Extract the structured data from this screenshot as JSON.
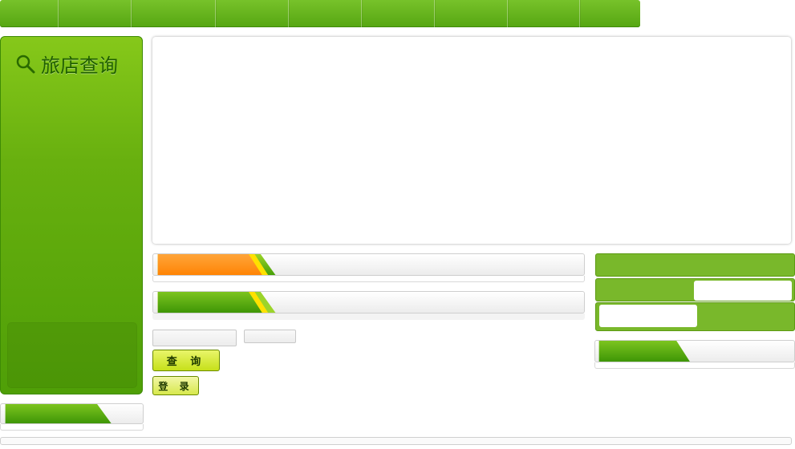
{
  "nav": {
    "tab_count": 9
  },
  "sidebar": {
    "title": "旅店查询",
    "icon": "search-icon"
  },
  "query_form": {
    "query_button": "查 询",
    "login_button": "登 录"
  },
  "colors": {
    "nav_green": "#5fae18",
    "sidebar_green": "#68b00f",
    "orange_tab": "#ff8d12",
    "green_tab": "#53a308",
    "right_block": "#79b82b"
  }
}
